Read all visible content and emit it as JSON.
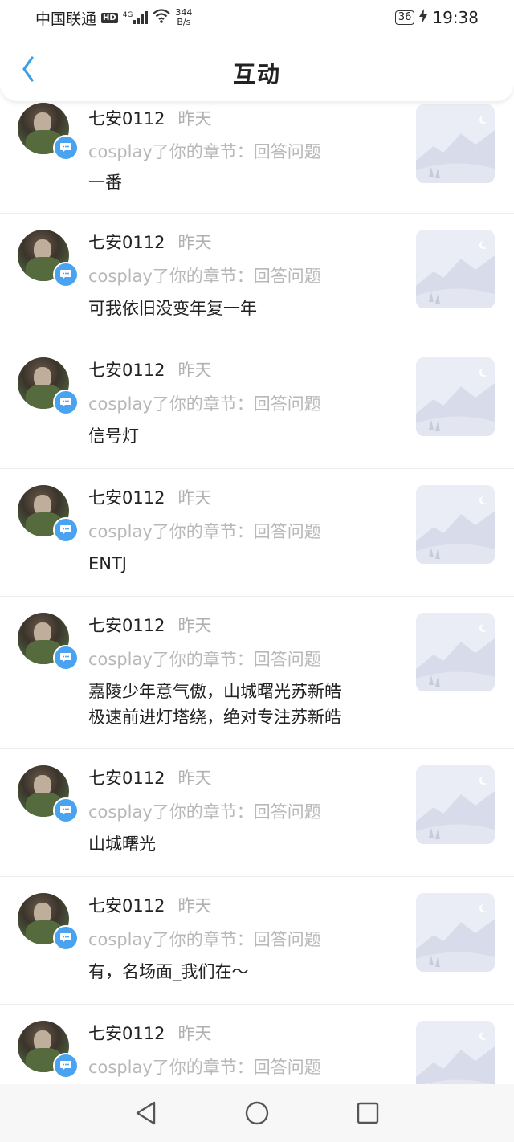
{
  "status": {
    "carrier": "中国联通",
    "hd": "HD",
    "signal": "4G",
    "speed_value": "344",
    "speed_unit": "B/s",
    "battery": "36",
    "time": "19:38"
  },
  "header": {
    "title": "互动"
  },
  "items": [
    {
      "username": "七安0112",
      "time": "昨天",
      "action": "cosplay了你的章节：回答问题",
      "content": "一番"
    },
    {
      "username": "七安0112",
      "time": "昨天",
      "action": "cosplay了你的章节：回答问题",
      "content": "可我依旧没变年复一年"
    },
    {
      "username": "七安0112",
      "time": "昨天",
      "action": "cosplay了你的章节：回答问题",
      "content": "信号灯"
    },
    {
      "username": "七安0112",
      "time": "昨天",
      "action": "cosplay了你的章节：回答问题",
      "content": "ENTJ"
    },
    {
      "username": "七安0112",
      "time": "昨天",
      "action": "cosplay了你的章节：回答问题",
      "content": "嘉陵少年意气傲，山城曙光苏新皓\n极速前进灯塔绕，绝对专注苏新皓"
    },
    {
      "username": "七安0112",
      "time": "昨天",
      "action": "cosplay了你的章节：回答问题",
      "content": "山城曙光"
    },
    {
      "username": "七安0112",
      "time": "昨天",
      "action": "cosplay了你的章节：回答问题",
      "content": "有，名场面_我们在～"
    },
    {
      "username": "七安0112",
      "time": "昨天",
      "action": "cosplay了你的章节：回答问题",
      "content": ""
    }
  ],
  "colors": {
    "accent": "#4aa3f0",
    "muted_text": "#b0b0b0",
    "primary_text": "#222222"
  }
}
